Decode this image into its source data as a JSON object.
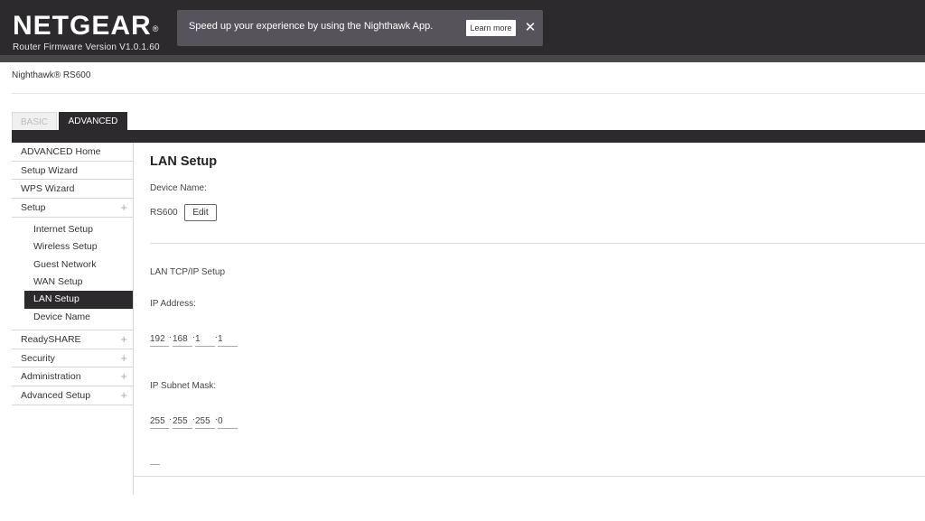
{
  "header": {
    "logo": "NETGEAR",
    "logo_mark": "®",
    "firmware_version": "Router Firmware Version V1.0.1.60",
    "promo_text": "Speed up your experience by using the Nighthawk App.",
    "learn_more_label": "Learn more",
    "close_label": "✕"
  },
  "model_name": "Nighthawk® RS600",
  "tabs": {
    "basic": "BASIC",
    "advanced": "ADVANCED"
  },
  "sidebar": {
    "items_top": [
      {
        "label": "ADVANCED Home"
      },
      {
        "label": "Setup Wizard"
      },
      {
        "label": "WPS Wizard"
      },
      {
        "label": "Setup",
        "expand": "+"
      }
    ],
    "setup_sub": [
      {
        "label": "Internet Setup"
      },
      {
        "label": "Wireless Setup"
      },
      {
        "label": "Guest Network"
      },
      {
        "label": "WAN Setup"
      },
      {
        "label": "LAN Setup",
        "active": true
      },
      {
        "label": "Device Name"
      }
    ],
    "items_bottom": [
      {
        "label": "ReadySHARE",
        "expand": "+"
      },
      {
        "label": "Security",
        "expand": "+"
      },
      {
        "label": "Administration",
        "expand": "+"
      },
      {
        "label": "Advanced Setup",
        "expand": "+"
      }
    ]
  },
  "content": {
    "title": "LAN Setup",
    "device_name_label": "Device Name:",
    "device_name_value": "RS600",
    "edit_label": "Edit",
    "tcpip_heading": "LAN TCP/IP Setup",
    "ip_address_label": "IP Address:",
    "ip_address": [
      "192",
      "168",
      "1",
      "1"
    ],
    "subnet_label": "IP Subnet Mask:",
    "subnet_mask": [
      "255",
      "255",
      "255",
      "0"
    ],
    "dot": "."
  },
  "colors": {
    "header_bg": "#2d2a2e",
    "promo_bg": "#56535a",
    "active_bg": "#2d2a2e"
  }
}
